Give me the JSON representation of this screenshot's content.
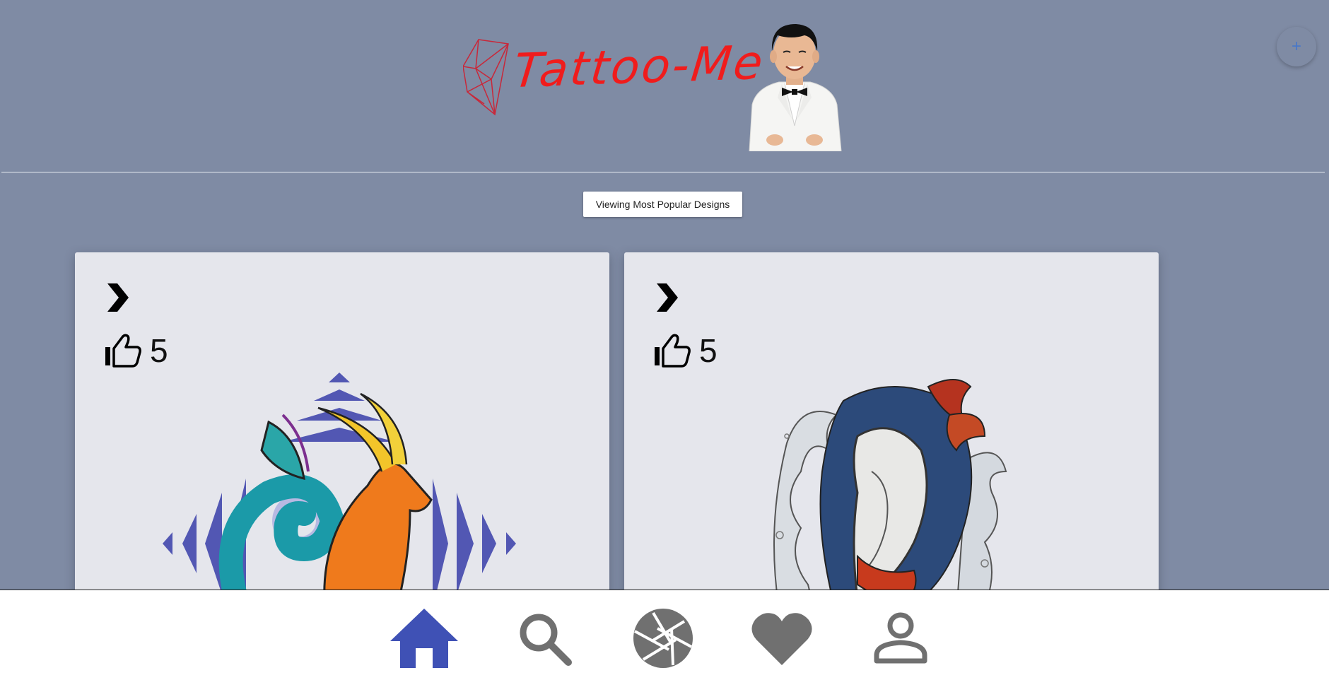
{
  "header": {
    "logo_text": "Tattoo-Me",
    "add_button_label": "+"
  },
  "view_toggle": {
    "label": "Viewing Most Popular Designs"
  },
  "cards": [
    {
      "likes": "5",
      "icon_expand": "chevron-right-icon",
      "icon_like": "thumbs-up-icon",
      "image": "capricorn-sea-goat-tattoo"
    },
    {
      "likes": "5",
      "icon_expand": "chevron-right-icon",
      "icon_like": "thumbs-up-icon",
      "image": "koi-dragon-waves-tattoo"
    }
  ],
  "bottom_nav": {
    "items": [
      {
        "icon": "home-icon",
        "active": true
      },
      {
        "icon": "search-icon",
        "active": false
      },
      {
        "icon": "camera-aperture-icon",
        "active": false
      },
      {
        "icon": "heart-icon",
        "active": false
      },
      {
        "icon": "profile-icon",
        "active": false
      }
    ]
  },
  "colors": {
    "background": "#7f8ba4",
    "card": "#e5e6ec",
    "logo_red": "#f01c1c",
    "active_nav": "#3f51b5",
    "inactive_nav": "#707070",
    "fab_plus": "#4a78c8"
  }
}
